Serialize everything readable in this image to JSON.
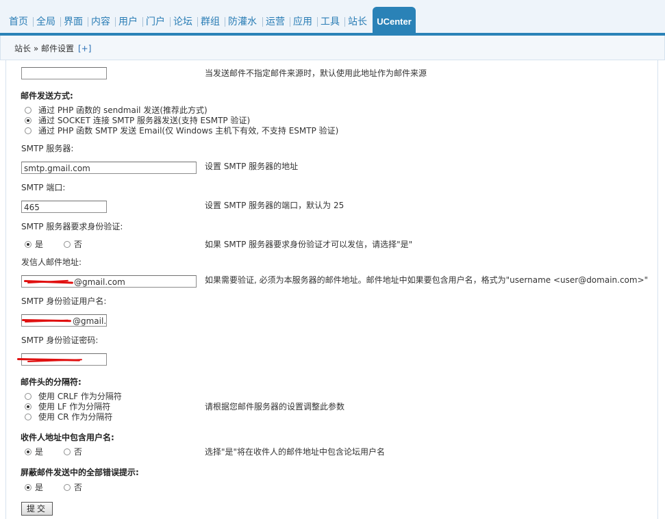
{
  "nav": {
    "items": [
      "首页",
      "全局",
      "界面",
      "内容",
      "用户",
      "门户",
      "论坛",
      "群组",
      "防灌水",
      "运营",
      "应用",
      "工具",
      "站长"
    ],
    "active": "UCenter",
    "accent": "#2a82b7"
  },
  "breadcrumb": {
    "path": "站长 » 邮件设置",
    "toggle": "[+]"
  },
  "sender_default": {
    "value": "",
    "hint": "当发送邮件不指定邮件来源时，默认使用此地址作为邮件来源"
  },
  "send_method": {
    "label": "邮件发送方式:",
    "options": [
      "通过 PHP 函数的 sendmail 发送(推荐此方式)",
      "通过 SOCKET 连接 SMTP 服务器发送(支持 ESMTP 验证)",
      "通过 PHP 函数 SMTP 发送 Email(仅 Windows 主机下有效, 不支持 ESMTP 验证)"
    ],
    "selected": 1
  },
  "smtp_server": {
    "label": "SMTP 服务器:",
    "value": "smtp.gmail.com",
    "hint": "设置 SMTP 服务器的地址"
  },
  "smtp_port": {
    "label": "SMTP 端口:",
    "value": "465",
    "hint": "设置 SMTP 服务器的端口，默认为 25"
  },
  "smtp_auth": {
    "label": "SMTP 服务器要求身份验证:",
    "yes": "是",
    "no": "否",
    "hint": "如果 SMTP 服务器要求身份验证才可以发信，请选择\"是\""
  },
  "from_address": {
    "label": "发信人邮件地址:",
    "value_visible": "@gmail.com",
    "hint": "如果需要验证, 必须为本服务器的邮件地址。邮件地址中如果要包含用户名，格式为\"username <user@domain.com>\""
  },
  "auth_user": {
    "label": "SMTP 身份验证用户名:",
    "value_visible": "@gmail."
  },
  "auth_pass": {
    "label": "SMTP 身份验证密码:"
  },
  "separator": {
    "label": "邮件头的分隔符:",
    "options": [
      "使用 CRLF 作为分隔符",
      "使用 LF 作为分隔符",
      "使用 CR 作为分隔符"
    ],
    "selected": 1,
    "hint": "请根据您邮件服务器的设置调整此参数"
  },
  "include_username": {
    "label": "收件人地址中包含用户名:",
    "yes": "是",
    "no": "否",
    "hint": "选择\"是\"将在收件人的邮件地址中包含论坛用户名"
  },
  "silent_errors": {
    "label": "屏蔽邮件发送中的全部错误提示:",
    "yes": "是",
    "no": "否"
  },
  "submit": {
    "label": "提交"
  }
}
